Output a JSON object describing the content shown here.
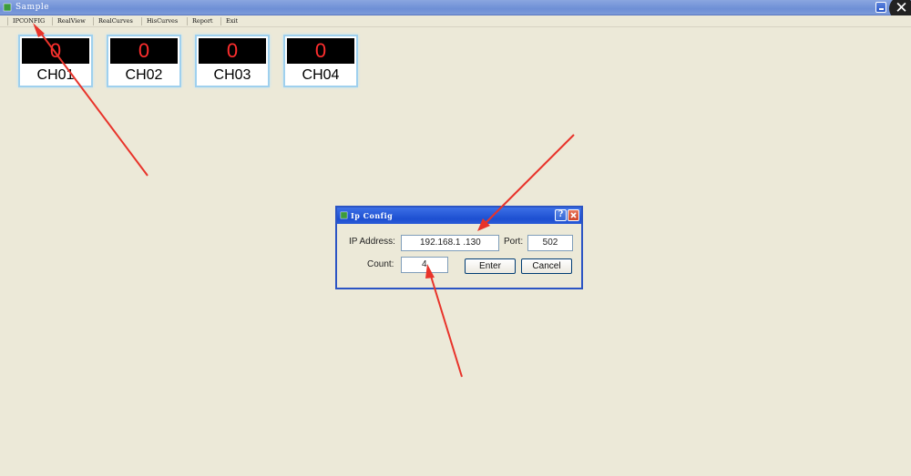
{
  "window": {
    "title": "Sample"
  },
  "menu": [
    "IPCONFIG",
    "RealView",
    "RealCurves",
    "HisCurves",
    "Report",
    "Exit"
  ],
  "channels": [
    {
      "value": "0",
      "name": "CH01"
    },
    {
      "value": "0",
      "name": "CH02"
    },
    {
      "value": "0",
      "name": "CH03"
    },
    {
      "value": "0",
      "name": "CH04"
    }
  ],
  "dialog": {
    "title": "Ip Config",
    "help_label": "?",
    "ip_label": "IP Address:",
    "ip_value": "192.168.1 .130",
    "port_label": "Port:",
    "port_value": "502",
    "count_label": "Count:",
    "count_value": "4",
    "enter_label": "Enter",
    "cancel_label": "Cancel"
  },
  "colors": {
    "annotation_arrow": "#e8332a",
    "channel_value": "#ff2e2e",
    "desktop": "#ece9d8"
  },
  "overlay": {
    "close_glyph": "✕"
  }
}
